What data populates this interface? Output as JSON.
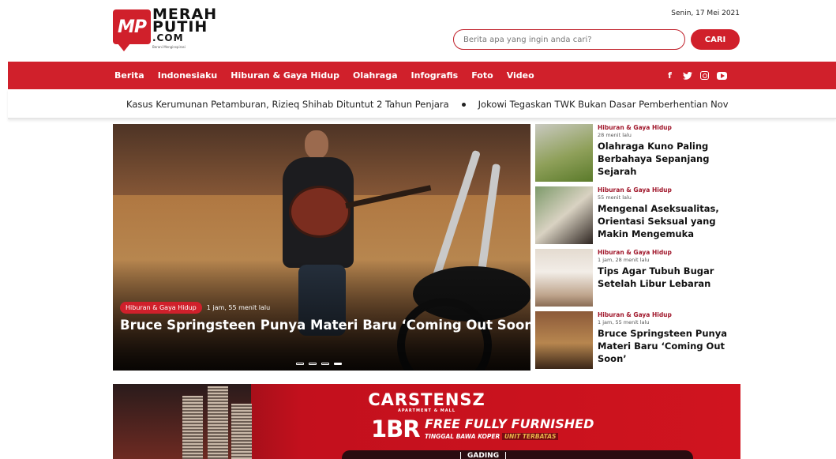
{
  "header": {
    "logo_badge": "MP",
    "logo_line1": "MERAH",
    "logo_line2": "PUTIH",
    "logo_line3": ".COM",
    "logo_tagline": "Berani Menginspirasi",
    "date": "Senin, 17 Mei 2021",
    "search_placeholder": "Berita apa yang ingin anda cari?",
    "search_button": "CARI"
  },
  "nav": {
    "items": [
      "Berita",
      "Indonesiaku",
      "Hiburan & Gaya Hidup",
      "Olahraga",
      "Infografis",
      "Foto",
      "Video"
    ],
    "social_icons": [
      "facebook-icon",
      "twitter-icon",
      "instagram-icon",
      "youtube-icon"
    ],
    "accent_color": "#d0202b"
  },
  "ticker": {
    "items": [
      "Kasus Kerumunan Petamburan, Rizieq Shihab Dituntut 2 Tahun Penjara",
      "Jokowi Tegaskan TWK Bukan Dasar Pemberhentian Nov"
    ]
  },
  "hero": {
    "category": "Hiburan & Gaya Hidup",
    "time": "1 jam, 55 menit lalu",
    "title": "Bruce Springsteen Punya Materi Baru ‘Coming Out Soon’",
    "slides": 4,
    "active_slide": 4
  },
  "side": {
    "items": [
      {
        "category": "Hiburan & Gaya Hidup",
        "time": "28 menit lalu",
        "title": "Olahraga Kuno Paling Berbahaya Sepanjang Sejarah"
      },
      {
        "category": "Hiburan & Gaya Hidup",
        "time": "55 menit lalu",
        "title": "Mengenal Aseksualitas, Orientasi Seksual yang Makin Mengemuka"
      },
      {
        "category": "Hiburan & Gaya Hidup",
        "time": "1 jam, 28 menit lalu",
        "title": "Tips Agar Tubuh Bugar Setelah Libur Lebaran"
      },
      {
        "category": "Hiburan & Gaya Hidup",
        "time": "1 jam, 55 menit lalu",
        "title": "Bruce Springsteen Punya Materi Baru ‘Coming Out Soon’"
      }
    ]
  },
  "banner": {
    "brand": "CARSTENSZ",
    "brand_sub": "APARTMENT & MALL",
    "big": "1BR",
    "offer": "FREE FULLY FURNISHED",
    "tagline": "TINGGAL BAWA KOPER",
    "tag_highlight": "UNIT TERBATAS",
    "logo": "GADING"
  }
}
